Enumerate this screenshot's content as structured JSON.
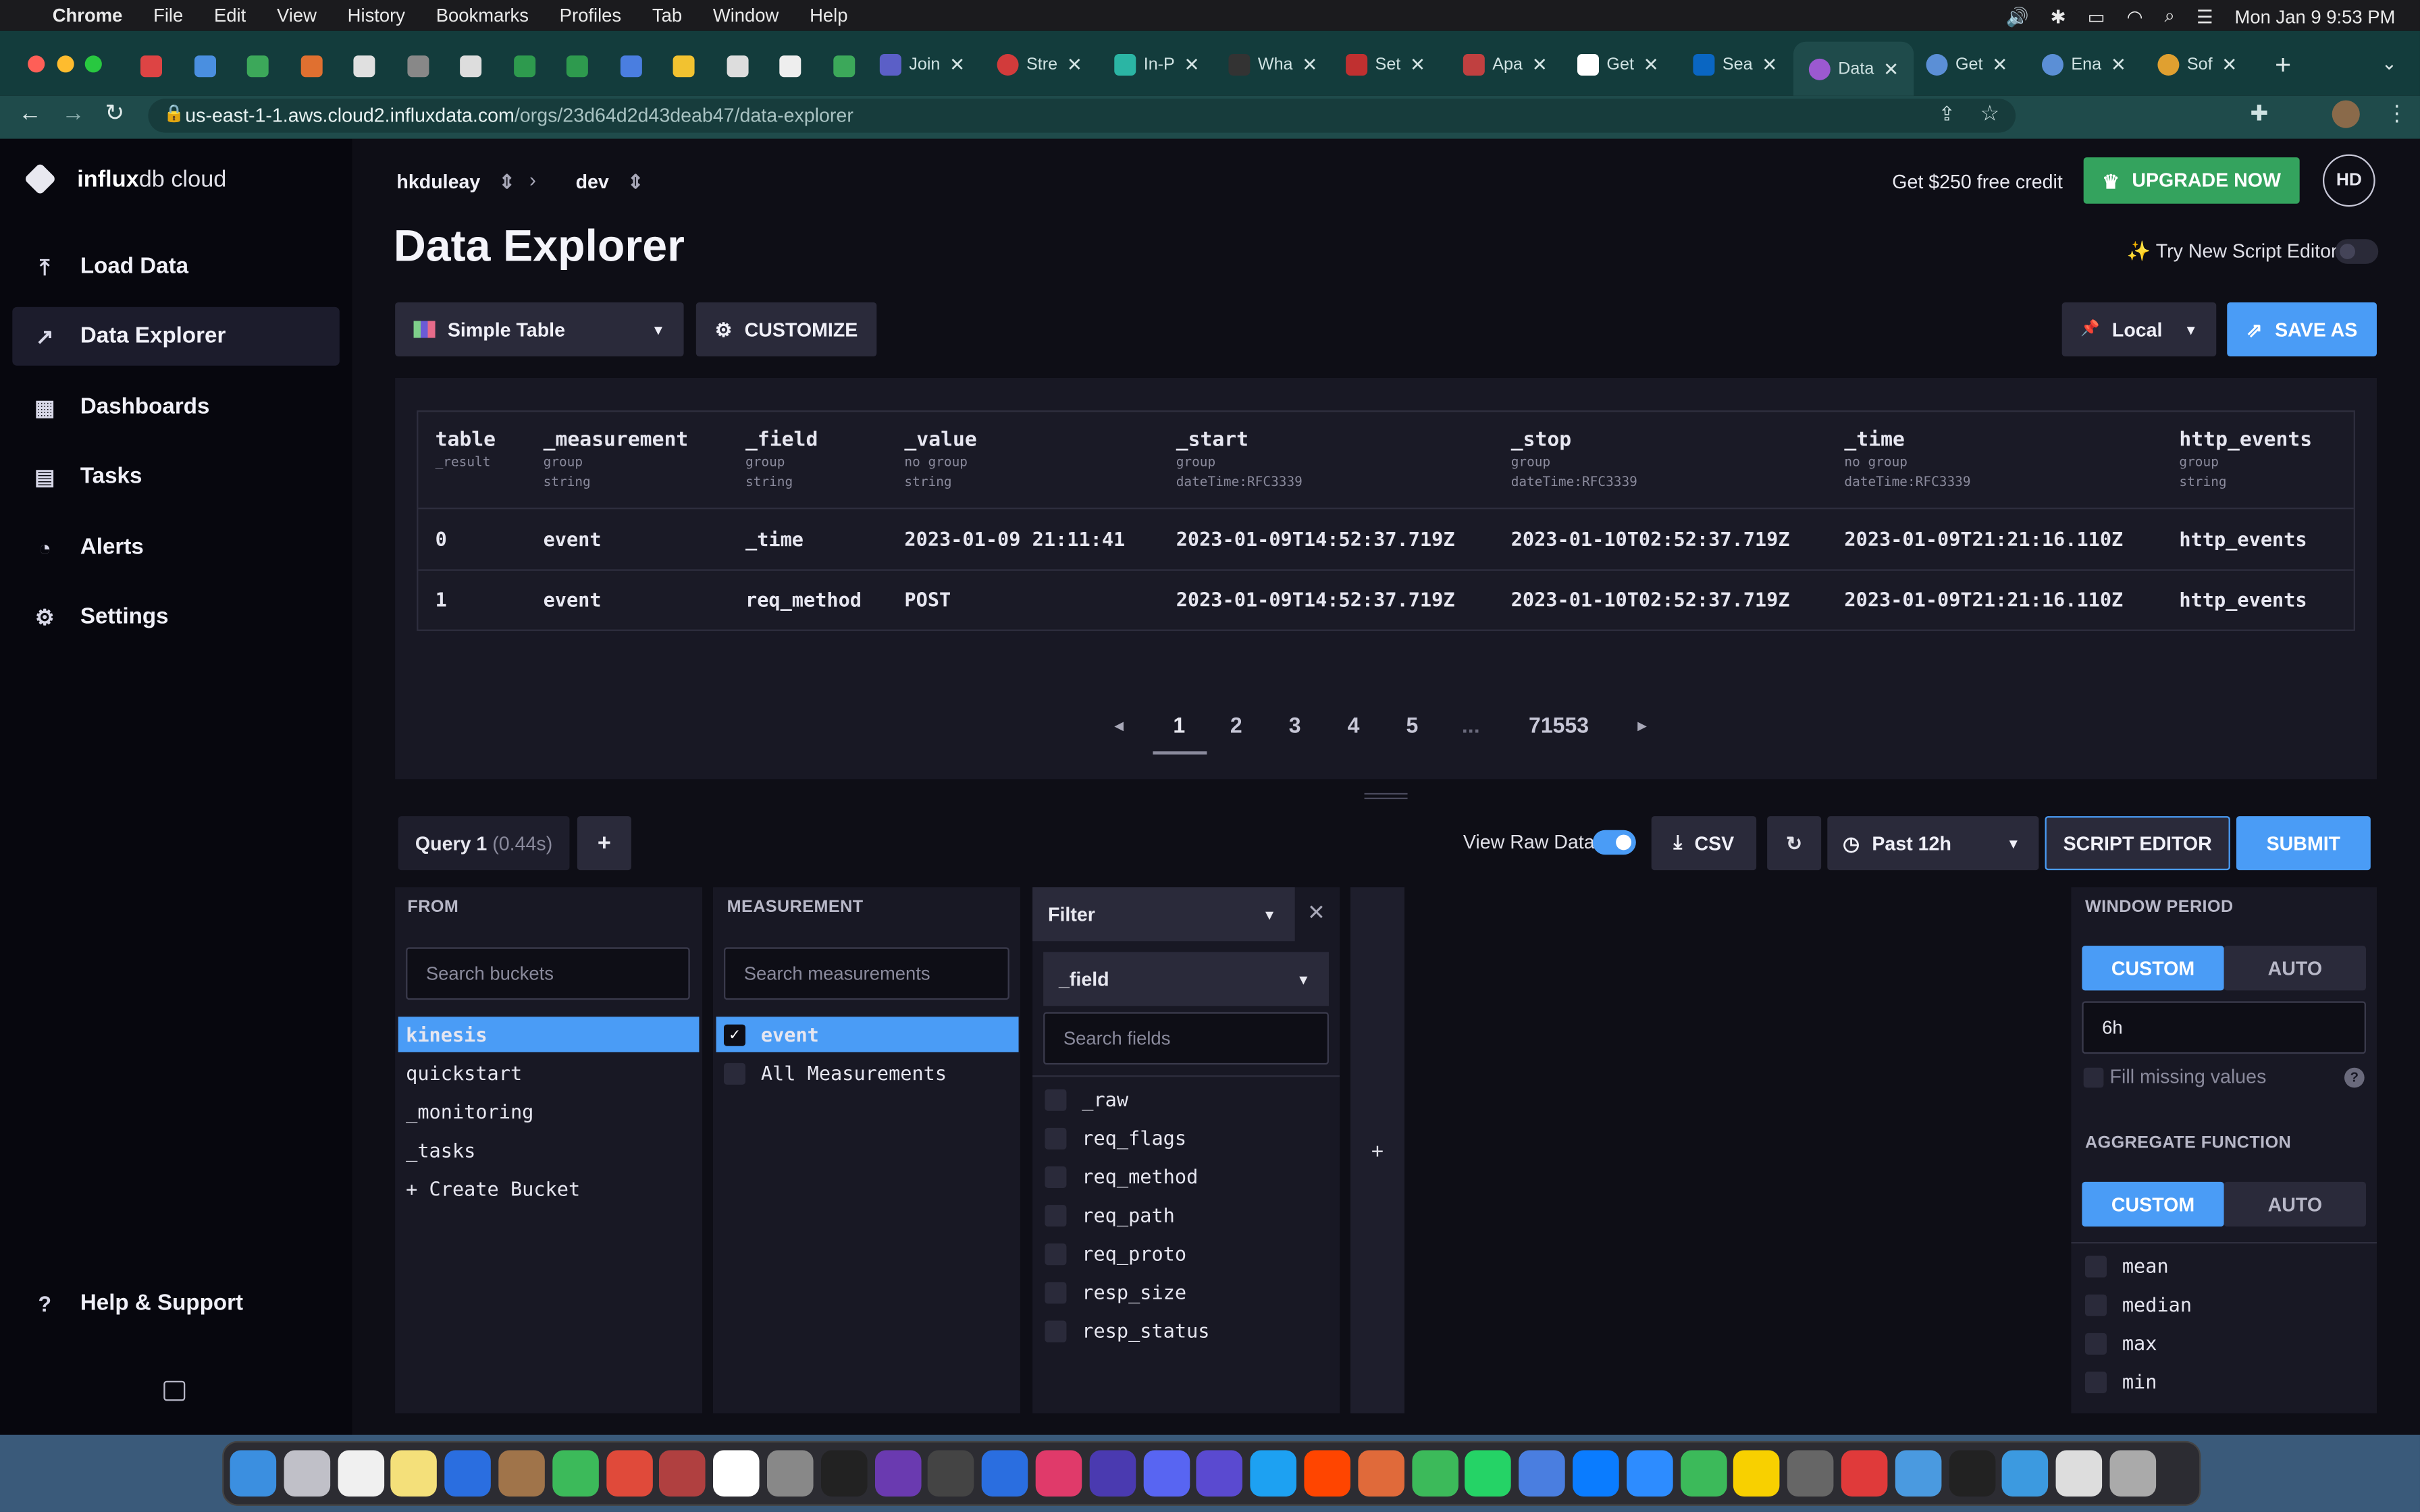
{
  "menubar": {
    "apple": "",
    "app": "Chrome",
    "menus": [
      "File",
      "Edit",
      "View",
      "History",
      "Bookmarks",
      "Profiles",
      "Tab",
      "Window",
      "Help"
    ],
    "clock": "Mon Jan 9  9:53 PM"
  },
  "browser": {
    "url_host": "us-east-1-1.aws.cloud2.influxdata.com",
    "url_path": "/orgs/23d64d2d43deab47/data-explorer",
    "tabs": [
      "Join",
      "Stre",
      "In-P",
      "Wha",
      "Set",
      "Apa",
      "Get",
      "Sea",
      "Data",
      "Get",
      "Ena",
      "Sof"
    ]
  },
  "brand": {
    "name_bold": "influx",
    "name_rest": "db cloud"
  },
  "nav": {
    "items": [
      "Load Data",
      "Data Explorer",
      "Dashboards",
      "Tasks",
      "Alerts",
      "Settings"
    ],
    "help": "Help & Support"
  },
  "header": {
    "org": "hkduleay",
    "bucket": "dev",
    "credit": "Get $250 free credit",
    "upgrade": "UPGRADE NOW",
    "avatar": "HD",
    "title": "Data Explorer",
    "script_toggle": "✨ Try New Script Editor"
  },
  "toolbar": {
    "viz": "Simple Table",
    "customize": "CUSTOMIZE",
    "timezone": "Local",
    "save": "SAVE AS"
  },
  "table": {
    "columns": [
      {
        "name": "table",
        "sub1": "_result",
        "sub2": ""
      },
      {
        "name": "_measurement",
        "sub1": "group",
        "sub2": "string"
      },
      {
        "name": "_field",
        "sub1": "group",
        "sub2": "string"
      },
      {
        "name": "_value",
        "sub1": "no group",
        "sub2": "string"
      },
      {
        "name": "_start",
        "sub1": "group",
        "sub2": "dateTime:RFC3339"
      },
      {
        "name": "_stop",
        "sub1": "group",
        "sub2": "dateTime:RFC3339"
      },
      {
        "name": "_time",
        "sub1": "no group",
        "sub2": "dateTime:RFC3339"
      },
      {
        "name": "http_events",
        "sub1": "group",
        "sub2": "string"
      }
    ],
    "rows": [
      [
        "0",
        "event",
        "_time",
        "2023-01-09 21:11:41",
        "2023-01-09T14:52:37.719Z",
        "2023-01-10T02:52:37.719Z",
        "2023-01-09T21:21:16.110Z",
        "http_events"
      ],
      [
        "1",
        "event",
        "req_method",
        "POST",
        "2023-01-09T14:52:37.719Z",
        "2023-01-10T02:52:37.719Z",
        "2023-01-09T21:21:16.110Z",
        "http_events"
      ]
    ]
  },
  "pagination": {
    "pages": [
      "1",
      "2",
      "3",
      "4",
      "5",
      "...",
      "71553"
    ],
    "current": "1"
  },
  "query": {
    "tab_label": "Query 1",
    "tab_time": "(0.44s)",
    "add": "+",
    "raw_label": "View Raw Data",
    "csv": "CSV",
    "range": "Past 12h",
    "script_editor": "SCRIPT EDITOR",
    "submit": "SUBMIT"
  },
  "from": {
    "header": "FROM",
    "placeholder": "Search buckets",
    "buckets": [
      "kinesis",
      "quickstart",
      "_monitoring",
      "_tasks",
      "+ Create Bucket"
    ],
    "selected": "kinesis"
  },
  "measurement": {
    "header": "MEASUREMENT",
    "placeholder": "Search measurements",
    "items": [
      "event",
      "All Measurements"
    ],
    "selected": "event"
  },
  "filter": {
    "header": "Filter",
    "key": "_field",
    "placeholder": "Search fields",
    "fields": [
      "_raw",
      "req_flags",
      "req_method",
      "req_path",
      "req_proto",
      "resp_size",
      "resp_status"
    ],
    "add": "+"
  },
  "window": {
    "header": "WINDOW PERIOD",
    "custom": "CUSTOM",
    "auto": "AUTO",
    "value": "6h",
    "fill": "Fill missing values",
    "help": "?"
  },
  "aggregate": {
    "header": "AGGREGATE FUNCTION",
    "custom": "CUSTOM",
    "auto": "AUTO",
    "functions": [
      "mean",
      "median",
      "max",
      "min"
    ]
  },
  "colors": {
    "accent": "#4a9cf6",
    "upgrade": "#34a35e",
    "sidebar_bg": "#07070e",
    "main_bg": "#0e0e16",
    "tabbar": "#133c3c"
  }
}
